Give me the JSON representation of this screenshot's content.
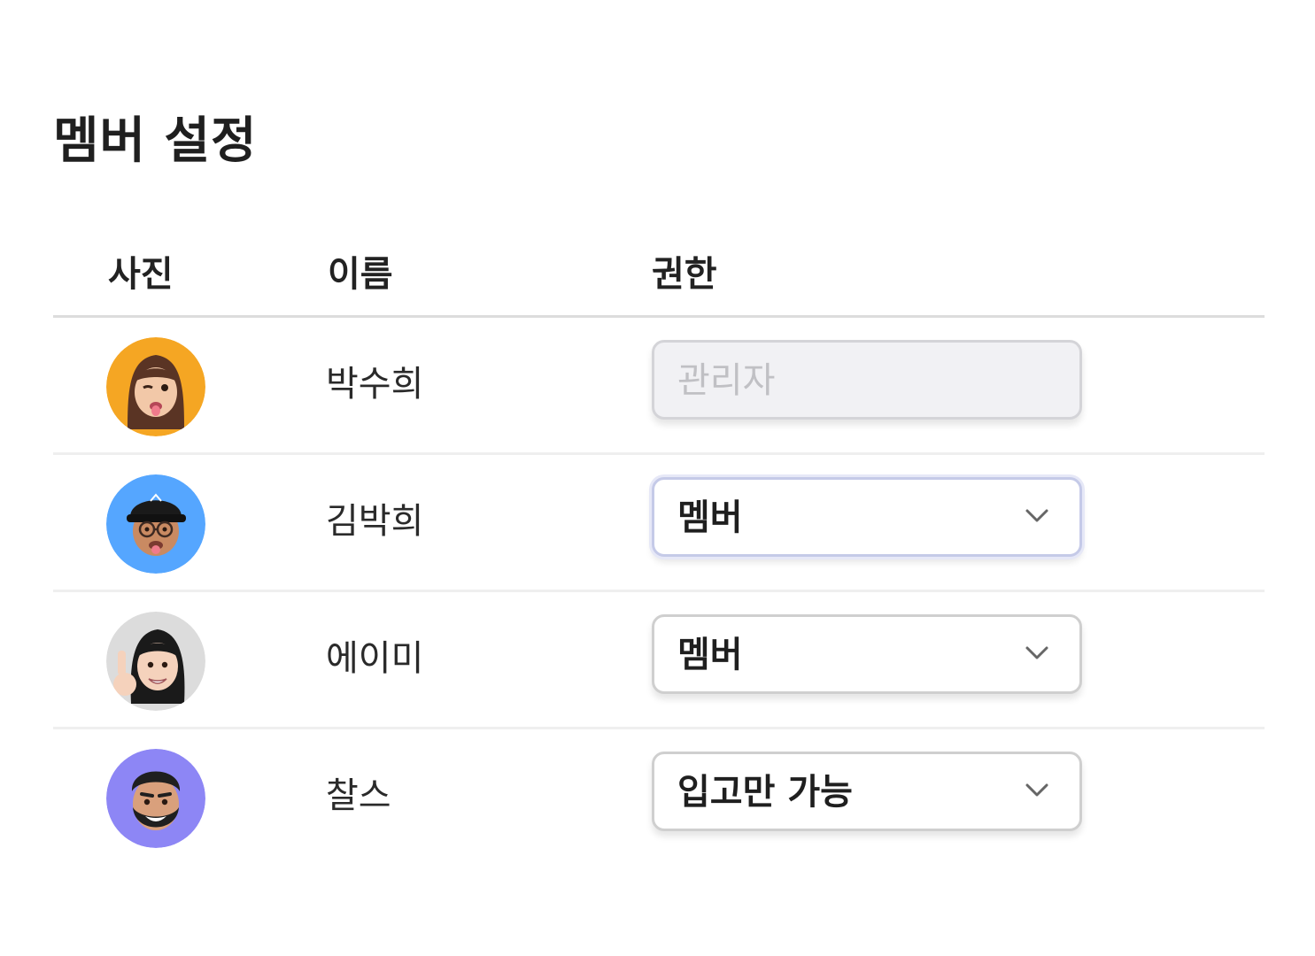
{
  "page": {
    "title": "멤버 설정"
  },
  "table": {
    "headers": {
      "photo": "사진",
      "name": "이름",
      "role": "권한"
    },
    "rows": [
      {
        "avatar_icon": "memoji-woman-winking-avatar",
        "avatar_bg": "#f5a623",
        "name": "박수희",
        "role": "관리자",
        "role_state": "disabled"
      },
      {
        "avatar_icon": "memoji-man-cap-glasses-avatar",
        "avatar_bg": "#55a6ff",
        "name": "김박희",
        "role": "멤버",
        "role_state": "focused"
      },
      {
        "avatar_icon": "memoji-woman-finger-up-avatar",
        "avatar_bg": "#dcdcdc",
        "name": "에이미",
        "role": "멤버",
        "role_state": "normal"
      },
      {
        "avatar_icon": "memoji-man-beard-avatar",
        "avatar_bg": "#8d86f5",
        "name": "찰스",
        "role": "입고만 가능",
        "role_state": "normal"
      }
    ]
  },
  "icons": {
    "dropdown": "chevron-down-icon"
  }
}
